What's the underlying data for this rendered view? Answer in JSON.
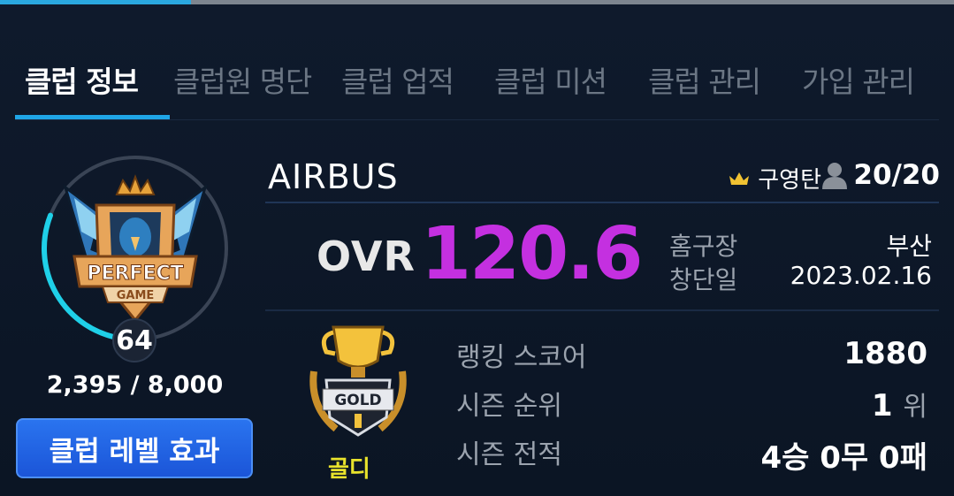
{
  "tabs": [
    {
      "label": "클럽 정보"
    },
    {
      "label": "클럽원 명단"
    },
    {
      "label": "클럽 업적"
    },
    {
      "label": "클럽 미션"
    },
    {
      "label": "클럽 관리"
    },
    {
      "label": "가입 관리"
    }
  ],
  "emblem": {
    "text_top": "PERFECT",
    "text_bottom": "GAME"
  },
  "level": {
    "value": "64",
    "xp": "2,395 / 8,000",
    "xp_fraction": 0.299
  },
  "level_button": "클럽 레벨 효과",
  "club": {
    "name": "AIRBUS",
    "owner": "구영탄",
    "members": "20/20",
    "ovr_label": "OVR",
    "ovr_value": "120.6",
    "home_label": "홈구장",
    "home_value": "부산",
    "founded_label": "창단일",
    "founded_value": "2023.02.16"
  },
  "tier": {
    "name": "골디",
    "badge_text": "GOLD"
  },
  "stats": {
    "ranking_label": "랭킹 스코어",
    "ranking_value": "1880",
    "season_rank_label": "시즌 순위",
    "season_rank_value": "1",
    "season_rank_unit": "위",
    "season_record_label": "시즌 전적",
    "season_record_value": "4승 0무 0패"
  },
  "colors": {
    "accent": "#1fa5e6",
    "ovr": "#c430e0",
    "tier": "#e9e32c",
    "button": "#1b55d8"
  }
}
